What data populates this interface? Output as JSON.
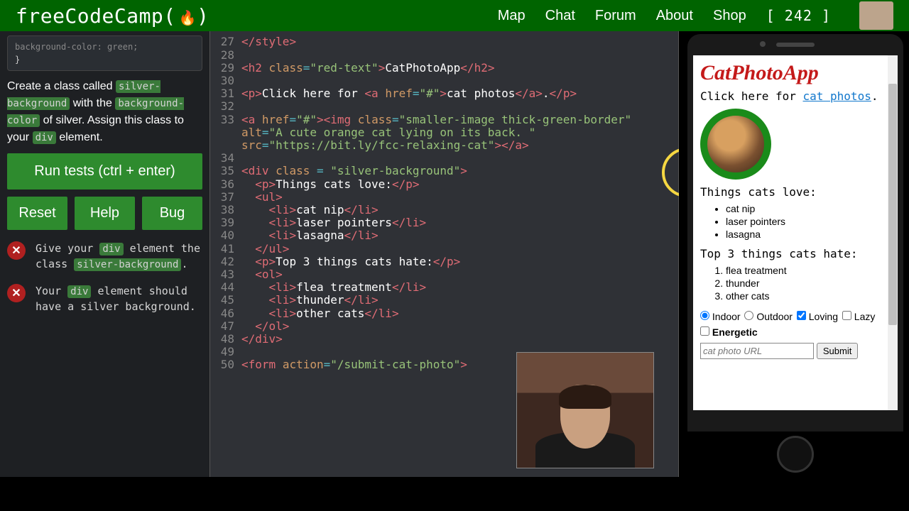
{
  "header": {
    "brand": "freeCodeCamp(",
    "flame": "🔥",
    "brand_close": ")",
    "nav": {
      "map": "Map",
      "chat": "Chat",
      "forum": "Forum",
      "about": "About",
      "shop": "Shop",
      "points": "[ 242 ]"
    }
  },
  "left": {
    "snippet_line1": "  background-color: green;",
    "snippet_line2": "}",
    "instr_1": "Create a class called ",
    "chip_silverbg": "silver-background",
    "instr_2": " with the ",
    "chip_bgcolor": "background-color",
    "instr_3": " of silver. Assign this class to your ",
    "chip_div": "div",
    "instr_4": " element.",
    "run": "Run tests (ctrl + enter)",
    "reset": "Reset",
    "help": "Help",
    "bug": "Bug",
    "test1_a": "Give your ",
    "test1_b": " element the class ",
    "test1_c": ".",
    "test2_a": "Your ",
    "test2_b": " element should have a silver background."
  },
  "editor": {
    "27": {
      "raw": "</style>"
    },
    "28": {
      "raw": ""
    },
    "29": {
      "raw": "<h2 class=\"red-text\">CatPhotoApp</h2>"
    },
    "30": {
      "raw": ""
    },
    "31": {
      "raw": "<p>Click here for <a href=\"#\">cat photos</a>.</p>"
    },
    "32": {
      "raw": ""
    },
    "33": {
      "raw": "<a href=\"#\"><img class=\"smaller-image thick-green-border\" alt=\"A cute orange cat lying on its back. \" src=\"https://bit.ly/fcc-relaxing-cat\"></a>"
    },
    "34": {
      "raw": ""
    },
    "35": {
      "raw": "<div class = \"silver-background\">"
    },
    "36": {
      "raw": "  <p>Things cats love:</p>"
    },
    "37": {
      "raw": "  <ul>"
    },
    "38": {
      "raw": "    <li>cat nip</li>"
    },
    "39": {
      "raw": "    <li>laser pointers</li>"
    },
    "40": {
      "raw": "    <li>lasagna</li>"
    },
    "41": {
      "raw": "  </ul>"
    },
    "42": {
      "raw": "  <p>Top 3 things cats hate:</p>"
    },
    "43": {
      "raw": "  <ol>"
    },
    "44": {
      "raw": "    <li>flea treatment</li>"
    },
    "45": {
      "raw": "    <li>thunder</li>"
    },
    "46": {
      "raw": "    <li>other cats</li>"
    },
    "47": {
      "raw": "  </ol>"
    },
    "48": {
      "raw": "</div>"
    },
    "49": {
      "raw": ""
    },
    "50": {
      "raw": "<form action=\"/submit-cat-photo\">"
    }
  },
  "preview": {
    "title": "CatPhotoApp",
    "click_pre": "Click here for ",
    "click_link": "cat photos",
    "click_post": ".",
    "love": "Things cats love:",
    "ul": [
      "cat nip",
      "laser pointers",
      "lasagna"
    ],
    "hate": "Top 3 things cats hate:",
    "ol": [
      "flea treatment",
      "thunder",
      "other cats"
    ],
    "radio1": "Indoor",
    "radio2": "Outdoor",
    "cb1": "Loving",
    "cb2": "Lazy",
    "cb3": "Energetic",
    "placeholder": "cat photo URL",
    "submit": "Submit"
  }
}
